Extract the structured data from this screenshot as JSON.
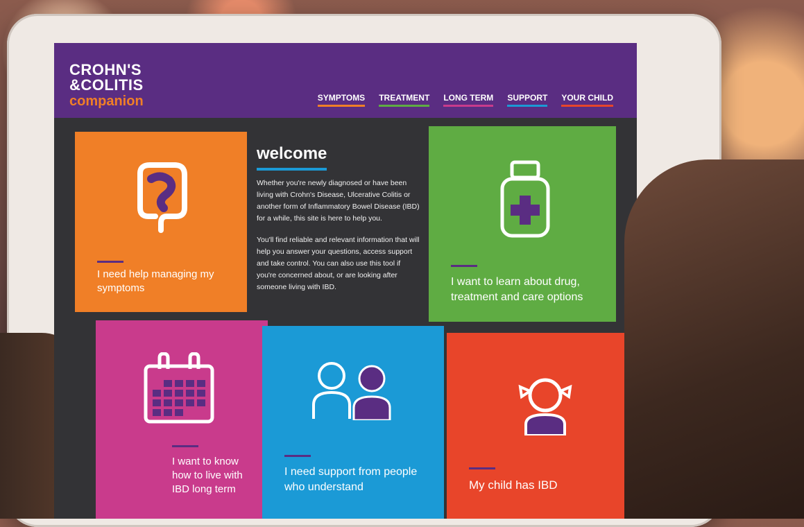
{
  "logo": {
    "line1": "CROHN'S",
    "line2": "&COLITIS",
    "line3": "companion"
  },
  "nav": {
    "symptoms": "SYMPTOMS",
    "treatment": "TREATMENT",
    "long_term": "LONG TERM",
    "support": "SUPPORT",
    "your_child": "YOUR CHILD"
  },
  "welcome": {
    "title": "welcome",
    "para1": "Whether you're newly diagnosed or have been living with Crohn's Disease, Ulcerative Colitis or another form of Inflammatory Bowel Disease (IBD) for a while, this site is here to help you.",
    "para2": "You'll find reliable and relevant information that will help you answer your questions, access support and take control. You can also use this tool if you're concerned about, or are looking after someone living with IBD."
  },
  "tiles": {
    "symptoms": "I need help managing my symptoms",
    "treatment": "I want to learn about drug, treatment and care options",
    "long_term": "I want to know how to live with IBD long term",
    "support": "I need support from people who understand",
    "child": "My child has IBD"
  },
  "icons": {
    "symptoms": "intestine-icon",
    "treatment": "medicine-bottle-icon",
    "long_term": "calendar-icon",
    "support": "people-icon",
    "child": "child-icon"
  },
  "colors": {
    "header": "#5a2d82",
    "orange": "#f07f27",
    "green": "#5fac43",
    "pink": "#c93b8c",
    "blue": "#1b9ad6",
    "red": "#e8452a",
    "purple": "#5a2d82"
  }
}
